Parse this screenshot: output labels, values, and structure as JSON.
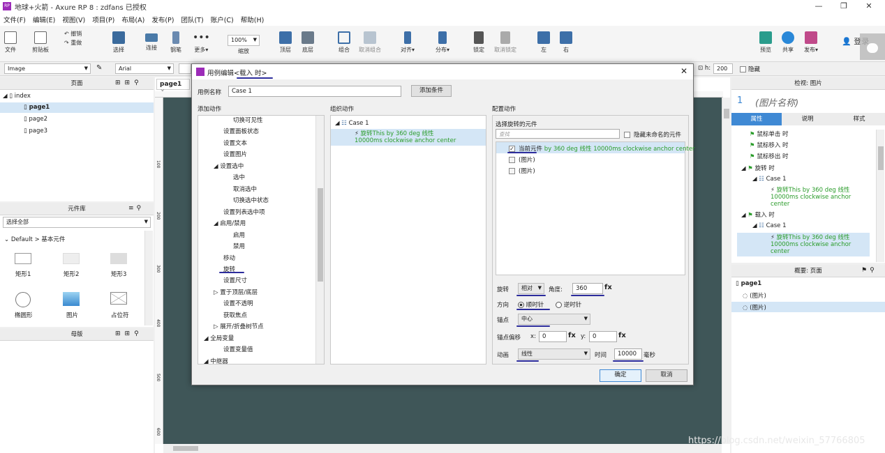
{
  "title": "地球+火箭 - Axure RP 8 : zdfans 已授权",
  "menu": [
    "文件(F)",
    "编辑(E)",
    "视图(V)",
    "项目(P)",
    "布局(A)",
    "发布(P)",
    "团队(T)",
    "账户(C)",
    "帮助(H)"
  ],
  "toolbar": {
    "file": "文件",
    "clipboard": "剪贴板",
    "undo": "撤销",
    "redo": "重做",
    "select": "选择",
    "connect": "连接",
    "pen": "钢笔",
    "more": "更多▾",
    "zoom_value": "100%",
    "zoom": "缩放",
    "top": "顶层",
    "bottom": "底层",
    "group": "组合",
    "ungroup": "取消组合",
    "align": "对齐▾",
    "distribute": "分布▾",
    "lock": "锁定",
    "unlock": "取消锁定",
    "left": "左",
    "right": "右",
    "preview": "预览",
    "share": "共享",
    "publish": "发布▾",
    "login": "登录"
  },
  "formatbar": {
    "style": "Image",
    "font": "Arial",
    "h_label": "h:",
    "h_value": "200",
    "hide": "隐藏"
  },
  "pages": {
    "title": "页面",
    "items": [
      "index",
      "page1",
      "page2",
      "page3"
    ]
  },
  "library": {
    "title": "元件库",
    "select": "选择全部",
    "group": "Default > 基本元件",
    "widgets": [
      "矩形1",
      "矩形2",
      "矩形3",
      "椭圆形",
      "图片",
      "占位符"
    ]
  },
  "masters": {
    "title": "母版"
  },
  "tab": "page1",
  "rulers": {
    "v": [
      "100",
      "200",
      "300",
      "400",
      "500",
      "600"
    ]
  },
  "inspector": {
    "title": "检视: 图片",
    "num": "1",
    "name": "(图片名称)",
    "tabs": [
      "属性",
      "说明",
      "样式"
    ],
    "events": [
      "鼠标单击 时",
      "鼠标移入 时",
      "鼠标移出 时",
      "旋转 时",
      "Case 1",
      "旋转This by 360 deg 线性 10000ms clockwise anchor center",
      "载入 时",
      "Case 1",
      "旋转This by 360 deg 线性 10000ms clockwise anchor center"
    ]
  },
  "outline": {
    "title": "概要: 页面",
    "items": [
      "page1",
      "(图片)",
      "(图片)"
    ]
  },
  "dialog": {
    "title_prefix": "用例编辑",
    "title_event": "<载入 时>",
    "case_name_label": "用例名称",
    "case_name": "Case 1",
    "add_condition": "添加条件",
    "col1": "添加动作",
    "col2": "组织动作",
    "col3": "配置动作",
    "actions": [
      "切换可见性",
      "设置面板状态",
      "设置文本",
      "设置图片",
      "设置选中",
      "选中",
      "取消选中",
      "切换选中状态",
      "设置列表选中项",
      "启用/禁用",
      "启用",
      "禁用",
      "移动",
      "旋转",
      "设置尺寸",
      "置于顶层/底层",
      "设置不透明",
      "获取焦点",
      "展开/折叠树节点",
      "全局变量",
      "设置变量值",
      "中继器"
    ],
    "org_case": "Case 1",
    "org_action": "旋转This by 360 deg 线性 10000ms clockwise anchor center",
    "select_label": "选择旋转的元件",
    "search_placeholder": "查找",
    "hide_unnamed": "隐藏未命名的元件",
    "targets": [
      "当前元件 by 360 deg 线性 10000ms clockwise anchor center",
      "(图片)",
      "(图片)"
    ],
    "target_prefix": "当前元件",
    "target_detail": "by 360 deg 线性 10000ms clockwise anchor center",
    "rotate_label": "旋转",
    "rotate_mode": "相对",
    "angle_label": "角度:",
    "angle": "360",
    "fx": "fx",
    "direction_label": "方向",
    "cw": "顺时针",
    "ccw": "逆时针",
    "anchor_label": "锚点",
    "anchor": "中心",
    "offset_label": "锚点偏移",
    "x": "x:",
    "x_val": "0",
    "y": "y:",
    "y_val": "0",
    "anim_label": "动画",
    "anim": "线性",
    "time_label": "时间",
    "time": "10000",
    "ms": "毫秒",
    "ok": "确定",
    "cancel": "取消"
  },
  "watermark": "https://blog.csdn.net/weixin_57766805",
  "colors": {
    "accent": "#3f89d4",
    "canvas": "#3f5658",
    "green": "#2a9c2a",
    "mark": "#2c2c9c"
  }
}
